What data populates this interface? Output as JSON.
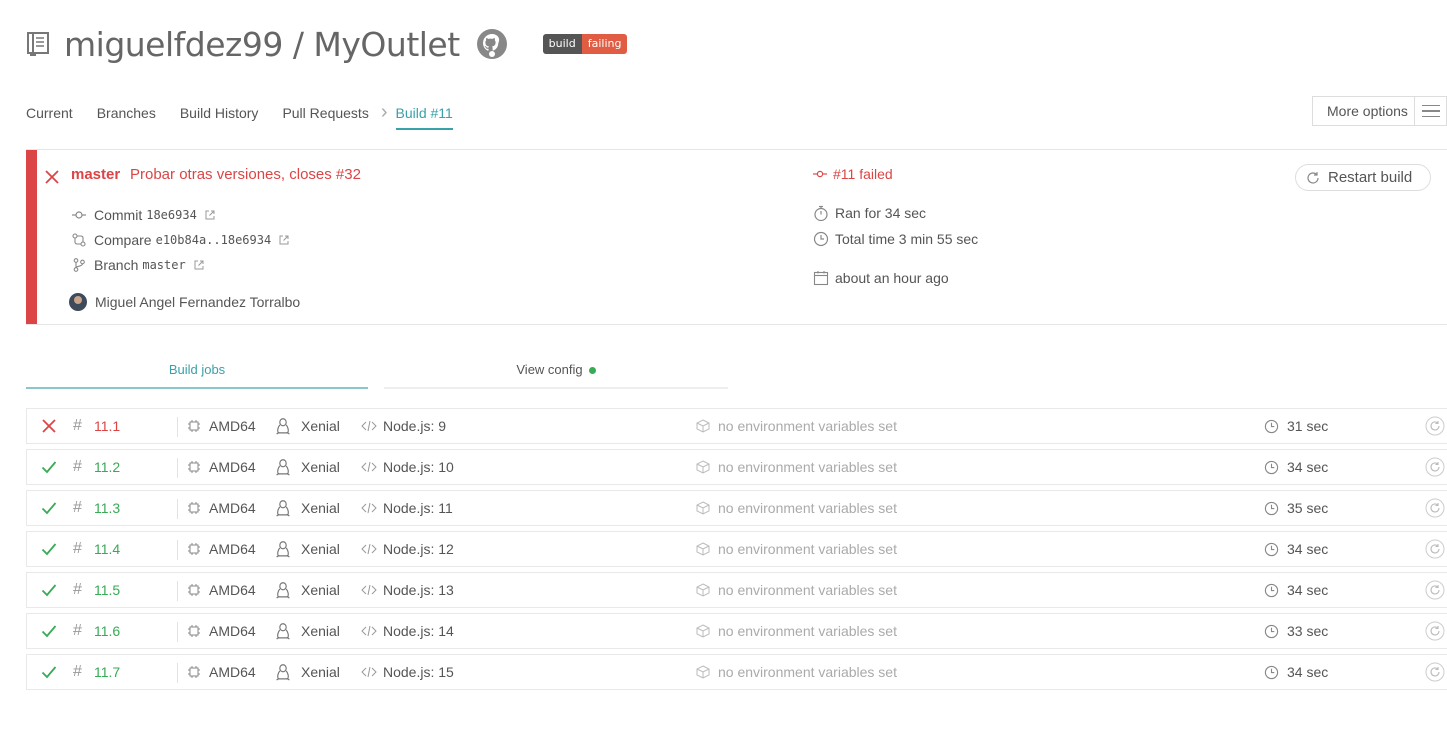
{
  "repo": {
    "title": "miguelfdez99 / MyOutlet",
    "badge_left": "build",
    "badge_right": "failing"
  },
  "tabs": [
    {
      "label": "Current"
    },
    {
      "label": "Branches"
    },
    {
      "label": "Build History"
    },
    {
      "label": "Pull Requests"
    },
    {
      "label": "Build #11"
    }
  ],
  "more_options": "More options",
  "build": {
    "branch": "master",
    "message": "Probar otras versiones, closes #32",
    "commit_label": "Commit",
    "commit_sha": "18e6934",
    "compare_label": "Compare",
    "compare_range": "e10b84a..18e6934",
    "branch_label": "Branch",
    "branch_name": "master",
    "author": "Miguel Angel Fernandez Torralbo",
    "status": "#11 failed",
    "ran_for": "Ran for 34 sec",
    "total_time": "Total time 3 min 55 sec",
    "finished": "about an hour ago",
    "restart_label": "Restart build"
  },
  "job_tabs": {
    "build_jobs": "Build jobs",
    "view_config": "View config"
  },
  "colors": {
    "failed": "#db4545",
    "passed": "#39aa56",
    "accent": "#39a1a9"
  },
  "jobs": [
    {
      "state": "failed",
      "number": "11.1",
      "cpu": "AMD64",
      "os": "Xenial",
      "lang": "Node.js: 9",
      "env": "no environment variables set",
      "time": "31 sec"
    },
    {
      "state": "passed",
      "number": "11.2",
      "cpu": "AMD64",
      "os": "Xenial",
      "lang": "Node.js: 10",
      "env": "no environment variables set",
      "time": "34 sec"
    },
    {
      "state": "passed",
      "number": "11.3",
      "cpu": "AMD64",
      "os": "Xenial",
      "lang": "Node.js: 11",
      "env": "no environment variables set",
      "time": "35 sec"
    },
    {
      "state": "passed",
      "number": "11.4",
      "cpu": "AMD64",
      "os": "Xenial",
      "lang": "Node.js: 12",
      "env": "no environment variables set",
      "time": "34 sec"
    },
    {
      "state": "passed",
      "number": "11.5",
      "cpu": "AMD64",
      "os": "Xenial",
      "lang": "Node.js: 13",
      "env": "no environment variables set",
      "time": "34 sec"
    },
    {
      "state": "passed",
      "number": "11.6",
      "cpu": "AMD64",
      "os": "Xenial",
      "lang": "Node.js: 14",
      "env": "no environment variables set",
      "time": "33 sec"
    },
    {
      "state": "passed",
      "number": "11.7",
      "cpu": "AMD64",
      "os": "Xenial",
      "lang": "Node.js: 15",
      "env": "no environment variables set",
      "time": "34 sec"
    }
  ]
}
